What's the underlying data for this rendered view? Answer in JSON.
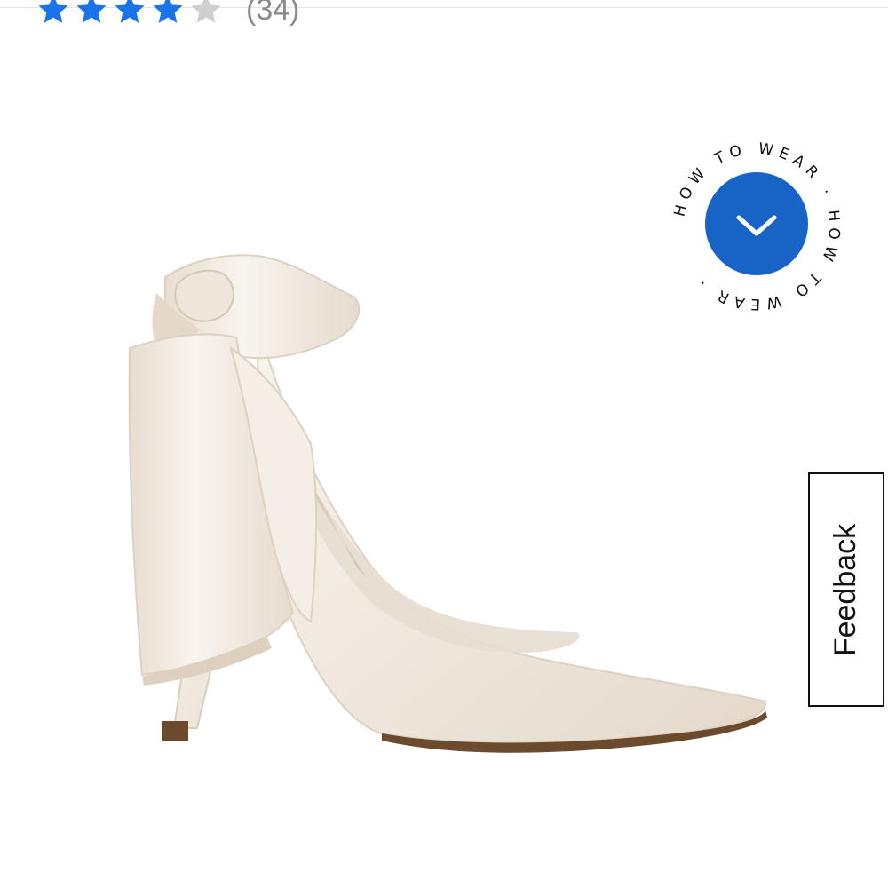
{
  "rating": {
    "stars_filled": 4,
    "stars_total": 5,
    "review_count_label": "(34)",
    "star_color": "#1a73e8",
    "star_empty_color": "#cfcfcf"
  },
  "product": {
    "image_alt": "white satin pointed-toe pump with bow",
    "colors": {
      "satin": "#f1ebe3",
      "satin_shadow": "#dcd1c3",
      "sole": "#6b4a2e"
    }
  },
  "how_to_wear": {
    "ring_text": "HOW TO WEAR · HOW TO WEAR · ",
    "button_color": "#1763c6",
    "icon": "chevron-down-icon"
  },
  "feedback": {
    "label": "Feedback"
  }
}
